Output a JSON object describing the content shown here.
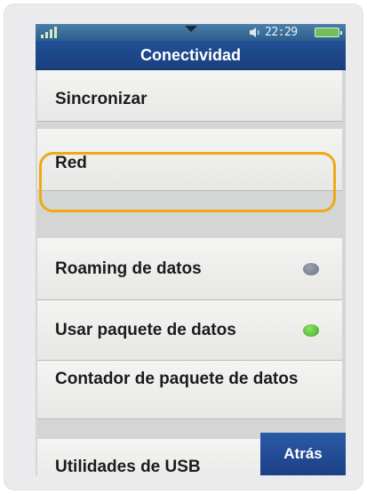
{
  "status_bar": {
    "time": "22:29",
    "signal_icon": "signal-bars-icon",
    "volume_icon": "speaker-icon",
    "battery_icon": "battery-icon"
  },
  "header": {
    "title": "Conectividad"
  },
  "menu": {
    "items": [
      {
        "label": "Sincronizar"
      },
      {
        "label": "Red",
        "highlighted": true
      },
      {
        "label": "Roaming de datos",
        "toggle": "off"
      },
      {
        "label": "Usar paquete de datos",
        "toggle": "on"
      },
      {
        "label": "Contador de paquete de datos"
      },
      {
        "label": "Utilidades de USB"
      }
    ]
  },
  "softkeys": {
    "back_label": "Atrás"
  },
  "colors": {
    "highlight_outline": "#f1a815",
    "header_blue": "#1f4a8f",
    "toggle_on": "#4fbf2a",
    "toggle_off": "#7b8396"
  }
}
